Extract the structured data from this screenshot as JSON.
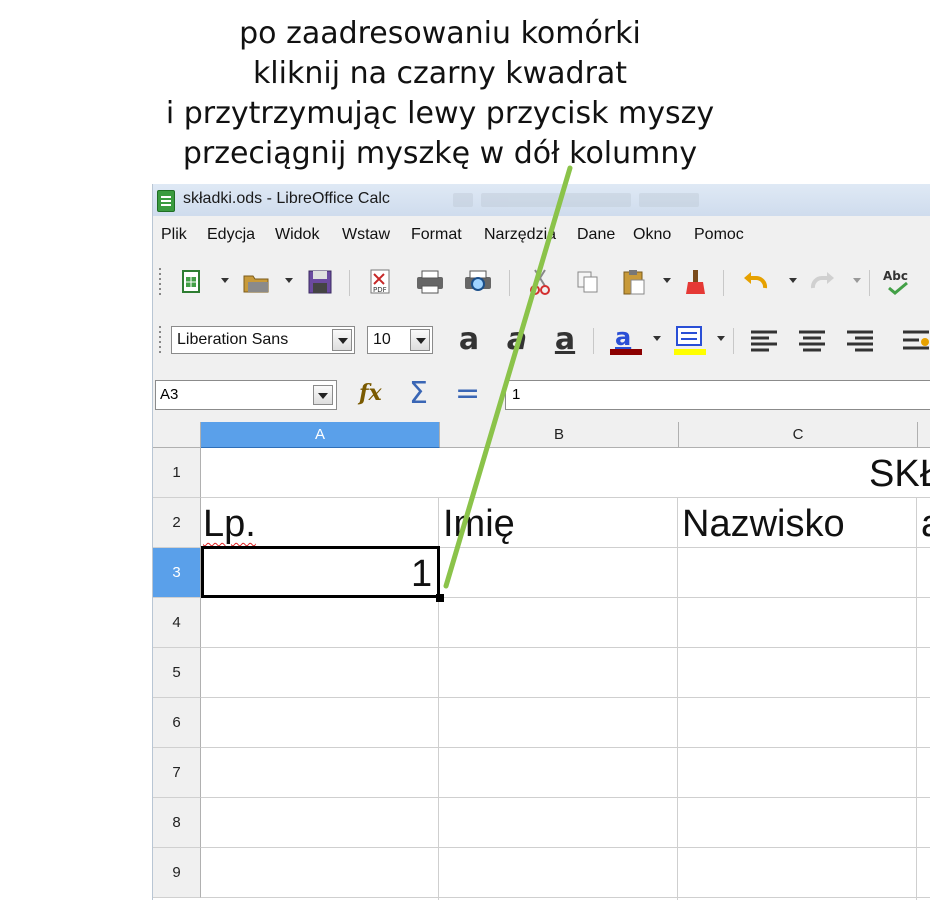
{
  "annotation": {
    "lines": [
      "po zaadresowaniu komórki",
      "kliknij na czarny kwadrat",
      "i przytrzymując lewy przycisk myszy",
      "przeciągnij myszkę w dół kolumny"
    ],
    "arrow_color": "#8bc34a"
  },
  "window": {
    "title": "składki.ods - LibreOffice Calc"
  },
  "menu": {
    "items": [
      "Plik",
      "Edycja",
      "Widok",
      "Wstaw",
      "Format",
      "Narzędzia",
      "Dane",
      "Okno",
      "Pomoc"
    ]
  },
  "toolbar": {
    "icons": [
      "new-icon",
      "open-icon",
      "save-icon",
      "export-pdf-icon",
      "print-icon",
      "print-preview-icon",
      "cut-icon",
      "copy-icon",
      "paste-icon",
      "clone-formatting-icon",
      "undo-icon",
      "redo-icon",
      "spellcheck-icon"
    ]
  },
  "format": {
    "font_name": "Liberation Sans",
    "font_size": "10",
    "bold_glyph": "a",
    "italic_glyph": "a",
    "underline_glyph": "a",
    "font_color": "#8b0000",
    "highlight_color": "#ffff00"
  },
  "formula_bar": {
    "name_box": "A3",
    "content": "1"
  },
  "sheet": {
    "columns": [
      "A",
      "B",
      "C"
    ],
    "selected_column": "A",
    "rows": [
      "1",
      "2",
      "3",
      "4",
      "5",
      "6",
      "7",
      "8",
      "9"
    ],
    "selected_row": "3",
    "cells": {
      "D1_partial": "SKŁ",
      "A2": "Lp.",
      "B2": "Imię",
      "C2": "Nazwisko",
      "D2_partial": "a",
      "A3": "1"
    },
    "active_cell": "A3"
  }
}
